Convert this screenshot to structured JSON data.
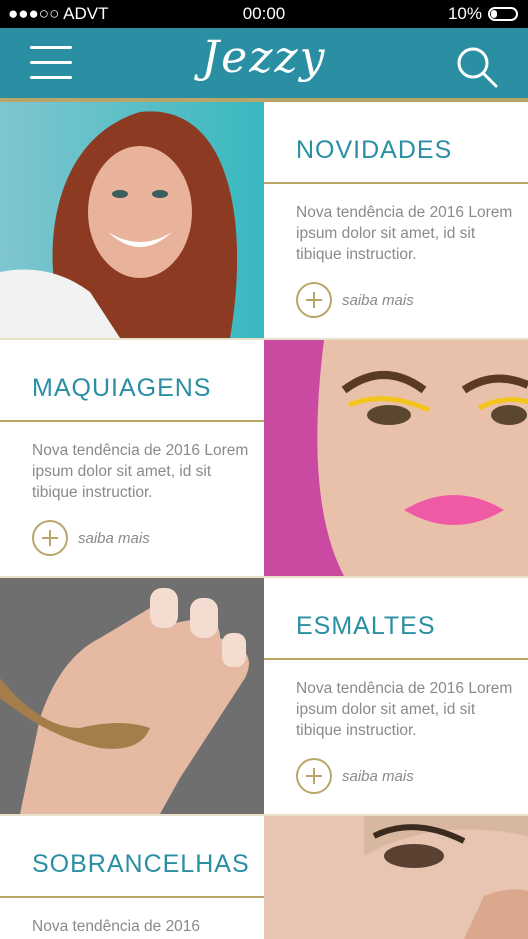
{
  "status_bar": {
    "carrier": "●●●○○ ADVT",
    "time": "00:00",
    "battery_pct": "10%"
  },
  "header": {
    "logo_text": "Jezzy"
  },
  "cards": [
    {
      "title": "NOVIDADES",
      "desc": "Nova tendência de 2016 Lorem ipsum dolor sit amet, id sit tibique instructior.",
      "more": "saiba mais"
    },
    {
      "title": "MAQUIAGENS",
      "desc": "Nova tendência de 2016 Lorem ipsum dolor sit amet, id sit tibique instructior.",
      "more": "saiba mais"
    },
    {
      "title": "ESMALTES",
      "desc": "Nova tendência de 2016 Lorem ipsum dolor sit amet, id sit tibique instructior.",
      "more": "saiba mais"
    },
    {
      "title": "SOBRANCELHAS",
      "desc": "Nova tendência de 2016",
      "more": ""
    }
  ],
  "colors": {
    "teal": "#2a8fa3",
    "gold": "#b9a56a",
    "text_gray": "#8a8a8a"
  }
}
